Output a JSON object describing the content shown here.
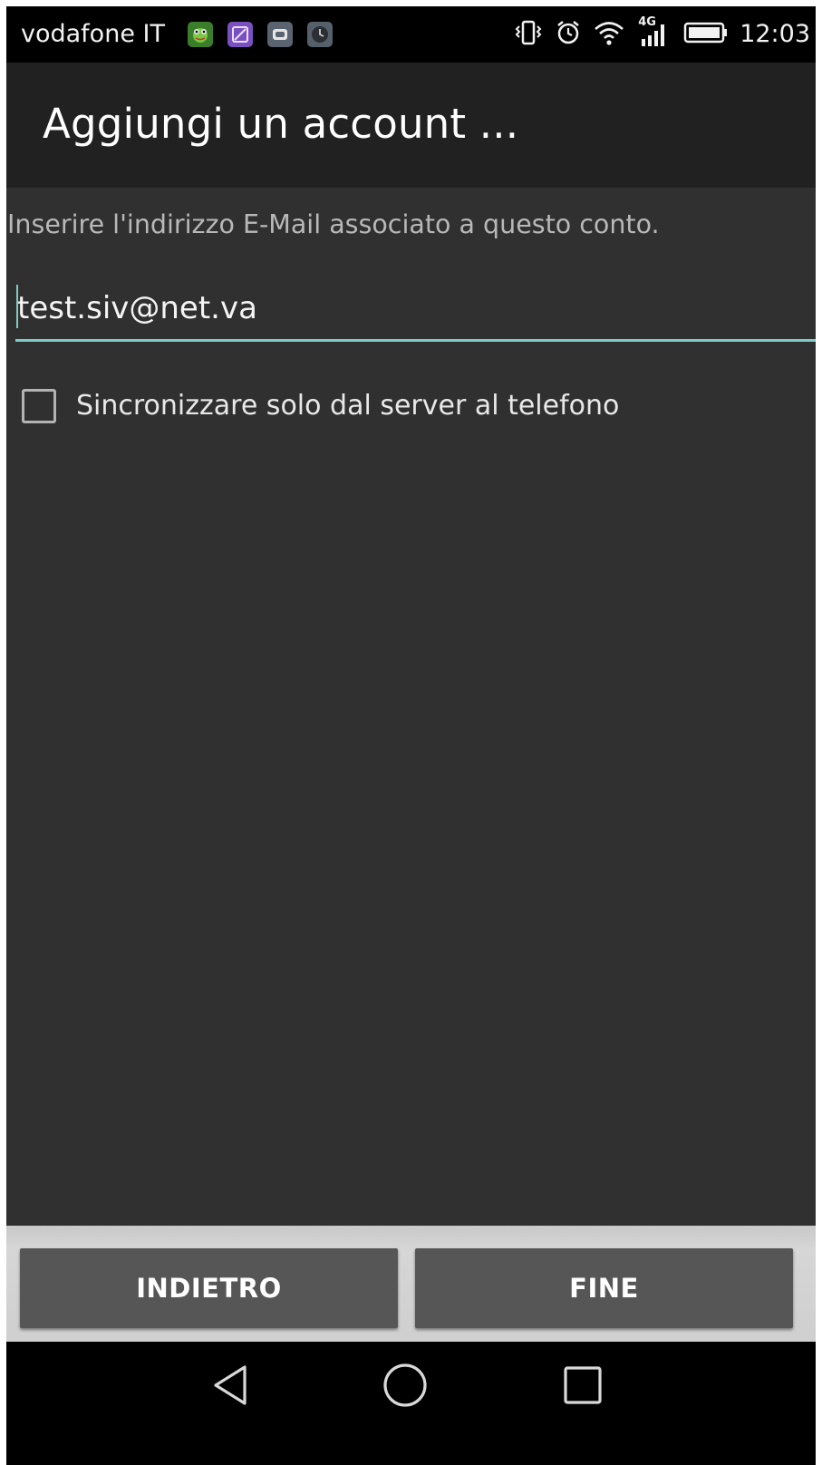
{
  "status_bar": {
    "carrier": "vodafone IT",
    "time": "12:03",
    "network_type": "4G",
    "icons": [
      "vibrate-icon",
      "alarm-icon",
      "wifi-icon",
      "signal-icon",
      "battery-icon"
    ],
    "notification_icons": [
      {
        "name": "frog-app-icon",
        "color": "#3a7d2a"
      },
      {
        "name": "gallery-app-icon",
        "color": "#7a4fc0"
      },
      {
        "name": "shield-app-icon",
        "color": "#5a6470"
      },
      {
        "name": "clock-app-icon",
        "color": "#55606b"
      }
    ]
  },
  "app_bar": {
    "title": "Aggiungi un account ..."
  },
  "form": {
    "instruction": "Inserire l'indirizzo E-Mail associato a questo conto.",
    "email_value": "test.siv@net.va",
    "checkbox_label": "Sincronizzare solo dal server al telefono",
    "checkbox_checked": false
  },
  "buttons": {
    "back_label": "INDIETRO",
    "done_label": "FINE"
  },
  "nav_bar": {
    "icons": [
      "back-icon",
      "home-icon",
      "recents-icon"
    ]
  },
  "colors": {
    "background": "#303030",
    "app_bar": "#212121",
    "accent": "#80cbc4",
    "button": "#565656",
    "button_bar": "#d0d0d0"
  }
}
